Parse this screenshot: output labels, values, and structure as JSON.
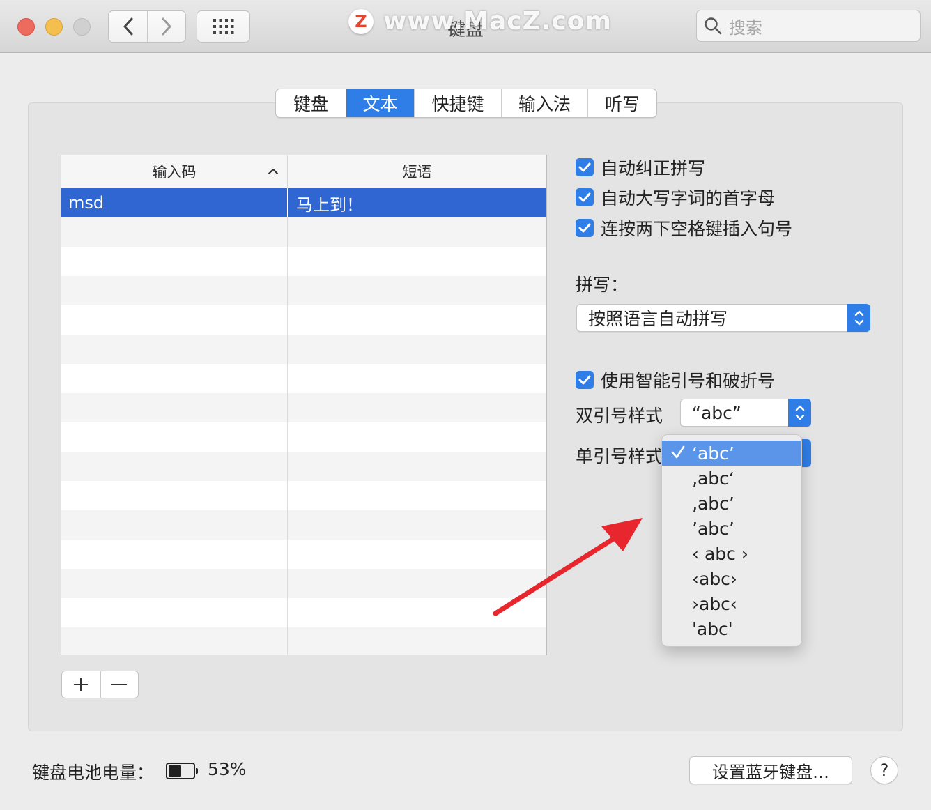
{
  "window": {
    "title": "键盘",
    "watermark_logo": "Z",
    "watermark": "www.MacZ.com",
    "search_placeholder": "搜索"
  },
  "tabs": [
    {
      "label": "键盘",
      "active": false
    },
    {
      "label": "文本",
      "active": true
    },
    {
      "label": "快捷键",
      "active": false
    },
    {
      "label": "输入法",
      "active": false
    },
    {
      "label": "听写",
      "active": false
    }
  ],
  "table": {
    "columns": [
      "输入码",
      "短语"
    ],
    "rows": [
      {
        "replace": "msd",
        "with": "马上到！",
        "selected": true
      }
    ]
  },
  "options": {
    "auto_correct": {
      "label": "自动纠正拼写",
      "checked": true
    },
    "auto_capitalize": {
      "label": "自动大写字词的首字母",
      "checked": true
    },
    "double_space_period": {
      "label": "连按两下空格键插入句号",
      "checked": true
    },
    "spelling_label": "拼写：",
    "spelling_value": "按照语言自动拼写",
    "smart_quotes": {
      "label": "使用智能引号和破折号",
      "checked": true
    },
    "double_quote_label": "双引号样式",
    "double_quote_value": "“abc”",
    "single_quote_label": "单引号样式"
  },
  "single_quote_menu": {
    "selected_index": 0,
    "items": [
      "‘abc’",
      "‚abc‘",
      "‚abc’",
      "’abc’",
      "‹ abc ›",
      "‹abc›",
      "›abc‹",
      "'abc'"
    ]
  },
  "footer": {
    "battery_label": "键盘电池电量：",
    "battery_level": 0.53,
    "battery_percent": "53%",
    "setup_bluetooth": "设置蓝牙键盘…",
    "help": "?"
  },
  "colors": {
    "accent": "#2f7ee8",
    "selection": "#2f66d2",
    "menu_highlight": "#5b95ea",
    "annotation_arrow": "#e8262d"
  }
}
